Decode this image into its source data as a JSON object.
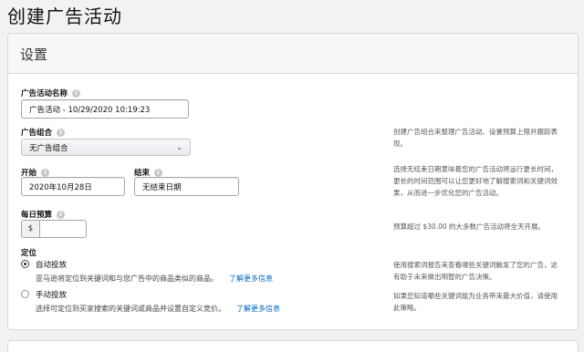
{
  "page": {
    "title": "创建广告活动"
  },
  "settings": {
    "title": "设置",
    "campaign_name": {
      "label": "广告活动名称",
      "value": "广告活动 - 10/29/2020 10:19:23"
    },
    "portfolio": {
      "label": "广告组合",
      "selected": "无广告组合",
      "hint": [
        "创建广告组合来整理广告活动、设置预算上限并跟踪表",
        "现。"
      ]
    },
    "start": {
      "label": "开始",
      "value": "2020年10月28日"
    },
    "end": {
      "label": "结束",
      "value": "无结束日期"
    },
    "date_hint": [
      "选择无结束日期意味着您的广告活动将运行更长时间，",
      "更长的时间范围可以让您更好地了解搜索词和关键词效",
      "果，从而进一步优化您的广告活动。"
    ],
    "daily_budget": {
      "label": "每日预算",
      "currency": "$",
      "value": ""
    },
    "budget_hint": "预算超过 $30.00 的大多数广告活动将全天开展。",
    "targeting": {
      "label": "定位",
      "auto": {
        "title": "自动投放",
        "desc": "亚马逊将定位到关键词和与您广告中的商品类似的商品。",
        "link": "了解更多信息",
        "hint": [
          "使用搜索词报告来查看哪些关键词触发了您的广告，这",
          "有助于未来做出明智的广告决策。"
        ]
      },
      "manual": {
        "title": "手动投放",
        "desc": "选择可定位到买家搜索的关键词或商品并设置自定义竞价。",
        "link": "了解更多信息",
        "hint": [
          "如果您知道哪些关键词能为业务带来最大价值，请使用",
          "此策略。"
        ]
      }
    },
    "info_glyph": "i"
  },
  "colors": {
    "link": "#0066c0",
    "border": "#d5d9d9",
    "background": "#f2f2f2"
  },
  "icons": {
    "info": "info-icon",
    "dropdown": "chevron-down-icon"
  }
}
